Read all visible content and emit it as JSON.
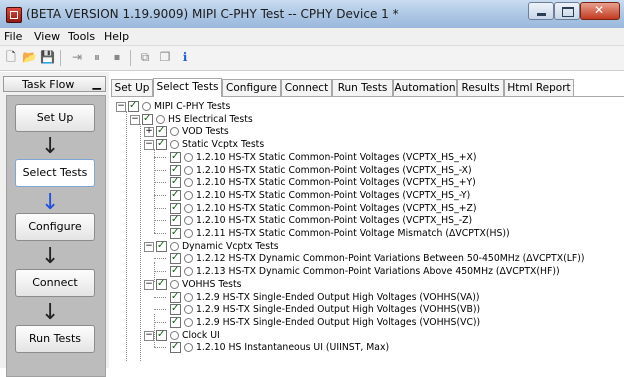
{
  "window": {
    "title": "(BETA VERSION 1.19.9009) MIPI C-PHY Test -- CPHY Device 1 *"
  },
  "menu": [
    "File",
    "View",
    "Tools",
    "Help"
  ],
  "task_flow": {
    "title": "Task Flow",
    "pin_icon": "pin-icon",
    "steps": [
      "Set Up",
      "Select Tests",
      "Configure",
      "Connect",
      "Run Tests"
    ],
    "active_step": "Select Tests"
  },
  "tabs": {
    "items": [
      "Set Up",
      "Select Tests",
      "Configure",
      "Connect",
      "Run Tests",
      "Automation",
      "Results",
      "Html Report"
    ],
    "active": "Select Tests"
  },
  "tree": [
    {
      "label": "MIPI C-PHY Tests",
      "level": 0,
      "expander": "−"
    },
    {
      "label": "HS Electrical Tests",
      "level": 1,
      "expander": "−"
    },
    {
      "label": "VOD Tests",
      "level": 2,
      "expander": "+"
    },
    {
      "label": "Static Vcptx Tests",
      "level": 2,
      "expander": "−"
    },
    {
      "label": "1.2.10 HS-TX Static Common-Point Voltages (VCPTX_HS_+X)",
      "level": 3,
      "expander": ""
    },
    {
      "label": "1.2.10 HS-TX Static Common-Point Voltages (VCPTX_HS_-X)",
      "level": 3,
      "expander": ""
    },
    {
      "label": "1.2.10 HS-TX Static Common-Point Voltages (VCPTX_HS_+Y)",
      "level": 3,
      "expander": ""
    },
    {
      "label": "1.2.10 HS-TX Static Common-Point Voltages (VCPTX_HS_-Y)",
      "level": 3,
      "expander": ""
    },
    {
      "label": "1.2.10 HS-TX Static Common-Point Voltages (VCPTX_HS_+Z)",
      "level": 3,
      "expander": ""
    },
    {
      "label": "1.2.10 HS-TX Static Common-Point Voltages (VCPTX_HS_-Z)",
      "level": 3,
      "expander": ""
    },
    {
      "label": "1.2.11 HS-TX Static Common-Point Voltage Mismatch (ΔVCPTX(HS))",
      "level": 3,
      "expander": ""
    },
    {
      "label": "Dynamic Vcptx Tests",
      "level": 2,
      "expander": "−"
    },
    {
      "label": "1.2.12 HS-TX Dynamic Common-Point Variations Between 50-450MHz (ΔVCPTX(LF))",
      "level": 3,
      "expander": ""
    },
    {
      "label": "1.2.13 HS-TX Dynamic Common-Point Variations Above 450MHz (ΔVCPTX(HF))",
      "level": 3,
      "expander": ""
    },
    {
      "label": "VOHHS Tests",
      "level": 2,
      "expander": "−"
    },
    {
      "label": "1.2.9 HS-TX Single-Ended Output High Voltages (VOHHS(VA))",
      "level": 3,
      "expander": ""
    },
    {
      "label": "1.2.9 HS-TX Single-Ended Output High Voltages (VOHHS(VB))",
      "level": 3,
      "expander": ""
    },
    {
      "label": "1.2.9 HS-TX Single-Ended Output High Voltages (VOHHS(VC))",
      "level": 3,
      "expander": ""
    },
    {
      "label": "Clock UI",
      "level": 2,
      "expander": "−"
    },
    {
      "label": "1.2.10 HS Instantaneous UI (UIINST, Max)",
      "level": 3,
      "expander": ""
    }
  ]
}
